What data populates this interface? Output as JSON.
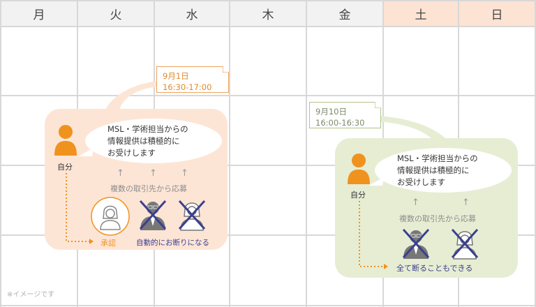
{
  "days": [
    "月",
    "火",
    "水",
    "木",
    "金",
    "土",
    "日"
  ],
  "colors": {
    "header_bg": "#f2f2f2",
    "weekend_bg": "#fde3d3",
    "grid": "#d8d8d8",
    "panel_left": "#fde5d6",
    "panel_right": "#e6edd3",
    "accent_orange": "#f0921e",
    "accent_navy": "#3b3f8f",
    "note_border_orange": "#eca55a",
    "note_border_green": "#b2c38a"
  },
  "left_case": {
    "note": {
      "date": "9月1日",
      "time": "16:30-17:00"
    },
    "person_label": "自分",
    "speech": [
      "MSL・学術担当からの",
      "情報提供は積極的に",
      "お受けします"
    ],
    "applicants_text": "複数の取引先から応募",
    "accept_label": "承認",
    "decline_label": "自動的にお断りになる"
  },
  "right_case": {
    "note": {
      "date": "9月10日",
      "time": "16:00-16:30"
    },
    "person_label": "自分",
    "speech": [
      "MSL・学術担当からの",
      "情報提供は積極的に",
      "お受けします"
    ],
    "applicants_text": "複数の取引先から応募",
    "decline_all_label": "全て断ることもできる"
  },
  "footnote": "※イメージです"
}
